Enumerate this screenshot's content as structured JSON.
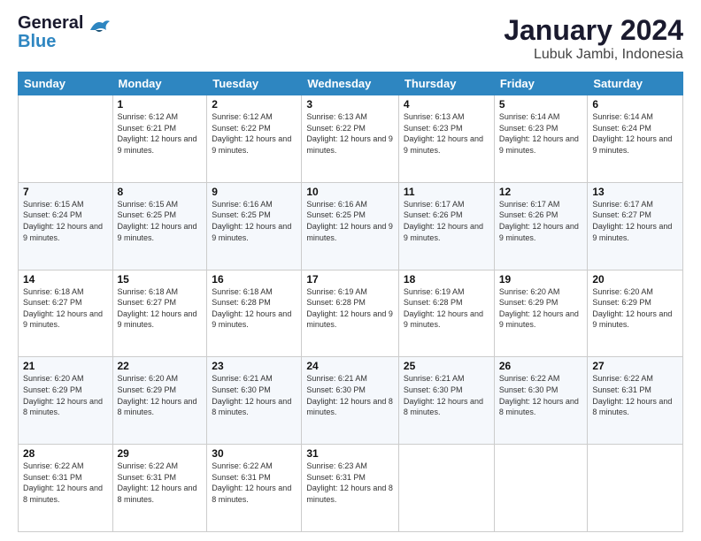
{
  "logo": {
    "line1": "General",
    "line2": "Blue"
  },
  "title": "January 2024",
  "subtitle": "Lubuk Jambi, Indonesia",
  "weekdays": [
    "Sunday",
    "Monday",
    "Tuesday",
    "Wednesday",
    "Thursday",
    "Friday",
    "Saturday"
  ],
  "weeks": [
    [
      {
        "day": "",
        "sunrise": "",
        "sunset": "",
        "daylight": ""
      },
      {
        "day": "1",
        "sunrise": "6:12 AM",
        "sunset": "6:21 PM",
        "daylight": "12 hours and 9 minutes."
      },
      {
        "day": "2",
        "sunrise": "6:12 AM",
        "sunset": "6:22 PM",
        "daylight": "12 hours and 9 minutes."
      },
      {
        "day": "3",
        "sunrise": "6:13 AM",
        "sunset": "6:22 PM",
        "daylight": "12 hours and 9 minutes."
      },
      {
        "day": "4",
        "sunrise": "6:13 AM",
        "sunset": "6:23 PM",
        "daylight": "12 hours and 9 minutes."
      },
      {
        "day": "5",
        "sunrise": "6:14 AM",
        "sunset": "6:23 PM",
        "daylight": "12 hours and 9 minutes."
      },
      {
        "day": "6",
        "sunrise": "6:14 AM",
        "sunset": "6:24 PM",
        "daylight": "12 hours and 9 minutes."
      }
    ],
    [
      {
        "day": "7",
        "sunrise": "6:15 AM",
        "sunset": "6:24 PM",
        "daylight": "12 hours and 9 minutes."
      },
      {
        "day": "8",
        "sunrise": "6:15 AM",
        "sunset": "6:25 PM",
        "daylight": "12 hours and 9 minutes."
      },
      {
        "day": "9",
        "sunrise": "6:16 AM",
        "sunset": "6:25 PM",
        "daylight": "12 hours and 9 minutes."
      },
      {
        "day": "10",
        "sunrise": "6:16 AM",
        "sunset": "6:25 PM",
        "daylight": "12 hours and 9 minutes."
      },
      {
        "day": "11",
        "sunrise": "6:17 AM",
        "sunset": "6:26 PM",
        "daylight": "12 hours and 9 minutes."
      },
      {
        "day": "12",
        "sunrise": "6:17 AM",
        "sunset": "6:26 PM",
        "daylight": "12 hours and 9 minutes."
      },
      {
        "day": "13",
        "sunrise": "6:17 AM",
        "sunset": "6:27 PM",
        "daylight": "12 hours and 9 minutes."
      }
    ],
    [
      {
        "day": "14",
        "sunrise": "6:18 AM",
        "sunset": "6:27 PM",
        "daylight": "12 hours and 9 minutes."
      },
      {
        "day": "15",
        "sunrise": "6:18 AM",
        "sunset": "6:27 PM",
        "daylight": "12 hours and 9 minutes."
      },
      {
        "day": "16",
        "sunrise": "6:18 AM",
        "sunset": "6:28 PM",
        "daylight": "12 hours and 9 minutes."
      },
      {
        "day": "17",
        "sunrise": "6:19 AM",
        "sunset": "6:28 PM",
        "daylight": "12 hours and 9 minutes."
      },
      {
        "day": "18",
        "sunrise": "6:19 AM",
        "sunset": "6:28 PM",
        "daylight": "12 hours and 9 minutes."
      },
      {
        "day": "19",
        "sunrise": "6:20 AM",
        "sunset": "6:29 PM",
        "daylight": "12 hours and 9 minutes."
      },
      {
        "day": "20",
        "sunrise": "6:20 AM",
        "sunset": "6:29 PM",
        "daylight": "12 hours and 9 minutes."
      }
    ],
    [
      {
        "day": "21",
        "sunrise": "6:20 AM",
        "sunset": "6:29 PM",
        "daylight": "12 hours and 8 minutes."
      },
      {
        "day": "22",
        "sunrise": "6:20 AM",
        "sunset": "6:29 PM",
        "daylight": "12 hours and 8 minutes."
      },
      {
        "day": "23",
        "sunrise": "6:21 AM",
        "sunset": "6:30 PM",
        "daylight": "12 hours and 8 minutes."
      },
      {
        "day": "24",
        "sunrise": "6:21 AM",
        "sunset": "6:30 PM",
        "daylight": "12 hours and 8 minutes."
      },
      {
        "day": "25",
        "sunrise": "6:21 AM",
        "sunset": "6:30 PM",
        "daylight": "12 hours and 8 minutes."
      },
      {
        "day": "26",
        "sunrise": "6:22 AM",
        "sunset": "6:30 PM",
        "daylight": "12 hours and 8 minutes."
      },
      {
        "day": "27",
        "sunrise": "6:22 AM",
        "sunset": "6:31 PM",
        "daylight": "12 hours and 8 minutes."
      }
    ],
    [
      {
        "day": "28",
        "sunrise": "6:22 AM",
        "sunset": "6:31 PM",
        "daylight": "12 hours and 8 minutes."
      },
      {
        "day": "29",
        "sunrise": "6:22 AM",
        "sunset": "6:31 PM",
        "daylight": "12 hours and 8 minutes."
      },
      {
        "day": "30",
        "sunrise": "6:22 AM",
        "sunset": "6:31 PM",
        "daylight": "12 hours and 8 minutes."
      },
      {
        "day": "31",
        "sunrise": "6:23 AM",
        "sunset": "6:31 PM",
        "daylight": "12 hours and 8 minutes."
      },
      {
        "day": "",
        "sunrise": "",
        "sunset": "",
        "daylight": ""
      },
      {
        "day": "",
        "sunrise": "",
        "sunset": "",
        "daylight": ""
      },
      {
        "day": "",
        "sunrise": "",
        "sunset": "",
        "daylight": ""
      }
    ]
  ],
  "labels": {
    "sunrise": "Sunrise:",
    "sunset": "Sunset:",
    "daylight": "Daylight:"
  }
}
